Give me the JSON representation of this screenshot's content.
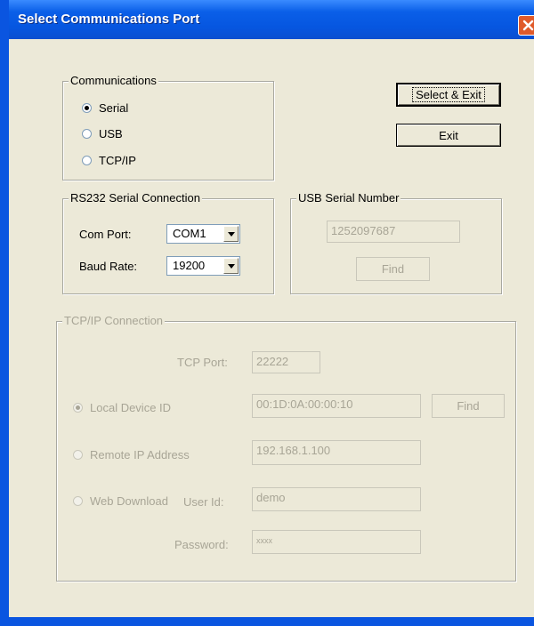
{
  "window": {
    "title": "Select Communications Port"
  },
  "communications": {
    "legend": "Communications",
    "options": [
      {
        "label": "Serial",
        "checked": true
      },
      {
        "label": "USB",
        "checked": false
      },
      {
        "label": "TCP/IP",
        "checked": false
      }
    ]
  },
  "buttons": {
    "select_exit": "Select & Exit",
    "exit": "Exit"
  },
  "rs232": {
    "legend": "RS232 Serial Connection",
    "com_port_label": "Com Port:",
    "com_port_value": "COM1",
    "baud_rate_label": "Baud Rate:",
    "baud_rate_value": "19200"
  },
  "usb": {
    "legend": "USB Serial Number",
    "serial": "1252097687",
    "find_label": "Find"
  },
  "tcpip": {
    "legend": "TCP/IP Connection",
    "tcp_port_label": "TCP Port:",
    "tcp_port_value": "22222",
    "local_device_label": "Local Device ID",
    "local_device_value": "00:1D:0A:00:00:10",
    "find_label": "Find",
    "remote_ip_label": "Remote IP Address",
    "remote_ip_value": "192.168.1.100",
    "web_download_label": "Web Download",
    "user_id_label": "User Id:",
    "user_id_value": "demo",
    "password_label": "Password:",
    "password_value": "xxxx",
    "selected_option": "Local Device ID"
  }
}
